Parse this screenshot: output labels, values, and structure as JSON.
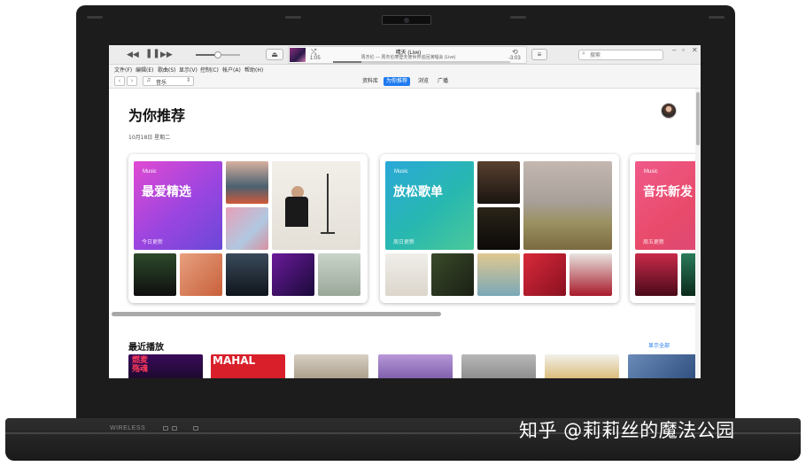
{
  "watermark": "知乎 @莉莉丝的魔法公园",
  "laptop": {
    "wireless_label": "WIRELESS"
  },
  "player": {
    "prev_icon": "rewind-icon",
    "play_icon": "pause-icon",
    "next_icon": "fast-forward-icon",
    "now_playing_title": "晴天 (Live)",
    "now_playing_subtitle": "周杰伦 — 周杰伦摩登天使世界巡回演唱会 (Live)",
    "elapsed": "1:05",
    "remaining": "-3:03",
    "progress_fraction": 0.16,
    "volume_fraction": 0.5
  },
  "search": {
    "placeholder": "搜索"
  },
  "menu": [
    "文件(F)",
    "编辑(E)",
    "歌曲(S)",
    "显示(V)",
    "控制(C)",
    "帐户(A)",
    "帮助(H)"
  ],
  "nav": {
    "back": "‹",
    "forward": "›",
    "source": "音乐",
    "tabs": [
      {
        "label": "资料库",
        "active": false
      },
      {
        "label": "为你推荐",
        "active": true
      },
      {
        "label": "浏览",
        "active": false
      },
      {
        "label": "广播",
        "active": false
      }
    ]
  },
  "page": {
    "title": "为你推荐",
    "date": "10月18日 星期二"
  },
  "mixes": [
    {
      "brand": " Music",
      "title": "最爱精选",
      "subtitle": "今日更新"
    },
    {
      "brand": " Music",
      "title": "放松歌单",
      "subtitle": "周日更新"
    },
    {
      "brand": " Music",
      "title": "音乐新发",
      "subtitle": "周五更新"
    }
  ],
  "recent": {
    "title": "最近播放",
    "show_all": "显示全部",
    "tiles": [
      "燃麦\n殇魂",
      "MAHAL",
      "",
      "",
      "",
      "",
      ""
    ]
  },
  "colors": {
    "accent": "#1e7bf0"
  }
}
